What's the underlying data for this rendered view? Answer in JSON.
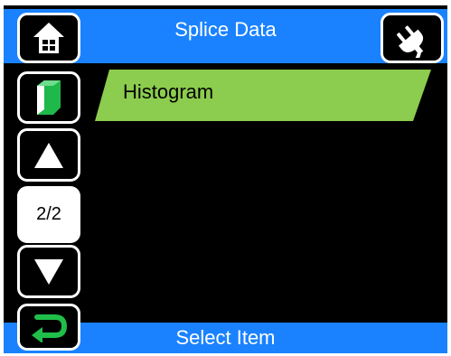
{
  "header": {
    "title": "Splice Data"
  },
  "sidebar": {
    "page_indicator": "2/2"
  },
  "list": {
    "items": [
      {
        "label": "Histogram"
      }
    ]
  },
  "footer": {
    "status": "Select Item"
  },
  "colors": {
    "bar_blue": "#1a82ff",
    "item_green": "#8ccc4e",
    "return_green": "#1fbf4a",
    "book_green": "#1fb84a",
    "background": "#000000"
  },
  "icons": {
    "home": "home-icon",
    "plug": "plug-icon",
    "book": "book-icon",
    "up": "arrow-up-icon",
    "down": "arrow-down-icon",
    "return": "return-icon"
  }
}
